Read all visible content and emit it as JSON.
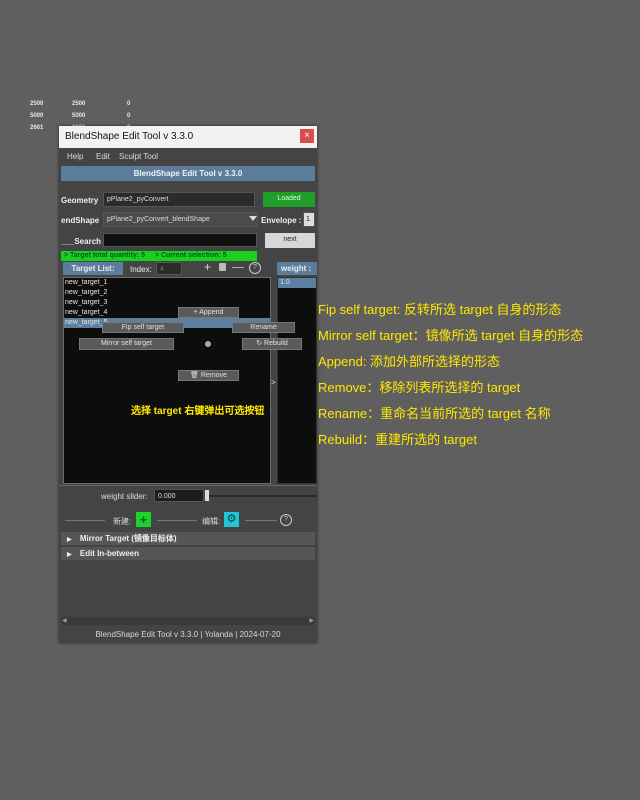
{
  "background_table": {
    "rows": [
      [
        "2500",
        "2500",
        "0"
      ],
      [
        "5000",
        "5000",
        "0"
      ],
      [
        "2601",
        "2601",
        "0"
      ]
    ]
  },
  "window": {
    "title": "BlendShape Edit Tool v 3.3.0",
    "close_glyph": "×"
  },
  "menu": {
    "items": [
      "Help",
      "Edit",
      "Sculpt Tool"
    ]
  },
  "banner": "BlendShape Edit Tool v 3.3.0",
  "geometry": {
    "label": "Geometry",
    "value": "pPlane2_pyConvert",
    "button": "Loaded"
  },
  "blendshape": {
    "label": "endShape",
    "value": "pPlane2_pyConvert_blendShape",
    "envelope_label": "Envelope :",
    "envelope_value": "1"
  },
  "search": {
    "label": "___Search",
    "value": "",
    "next_button": "next"
  },
  "status": {
    "total": "> Target total quantity: 5",
    "current": "> Current selection: 5"
  },
  "target_list": {
    "header": "Target List:",
    "index_label": "Index:",
    "index_value": "4",
    "items": [
      "new_target_1",
      "new_target_2",
      "new_target_3",
      "new_target_4",
      "new_target_5"
    ],
    "selected_index": 4
  },
  "weight_panel": {
    "header": "weight :",
    "value": "1.0",
    "arrow": ">"
  },
  "context_menu": {
    "append": "Append",
    "flip_self_target": "Fip self target",
    "rename": "Rename",
    "mirror_self_target": "Mirror self target",
    "rebuild": "Rebuild",
    "remove": "Remove"
  },
  "hint_text": "选择 target 右键弹出可选按钮",
  "weight_slider": {
    "label": "weight slider:",
    "value": "0.000"
  },
  "actions": {
    "new_label": "新建:",
    "edit_label": "编辑:",
    "help": "?"
  },
  "sections": [
    {
      "arrow": "▶",
      "label": "Mirror Target (镜像目标体)"
    },
    {
      "arrow": "▶",
      "label": "Edit In-between"
    }
  ],
  "footer": "BlendShape Edit Tool  v 3.3.0  | Yolanda |  2024-07-20",
  "annotations": [
    "Fip self target: 反转所选 target 自身的形态",
    "Mirror self target：镜像所选 target 自身的形态",
    "Append: 添加外部所选择的形态",
    "Remove：移除列表所选择的 target",
    "Rename：重命名当前所选的 target 名称",
    "Rebuild：重建所选的 target"
  ],
  "colors": {
    "annotation": "#ffe800",
    "loaded_button": "#1f9e2a",
    "status_bar": "#19d11d",
    "banner": "#5b7d9a",
    "close_button": "#d74d4d"
  }
}
